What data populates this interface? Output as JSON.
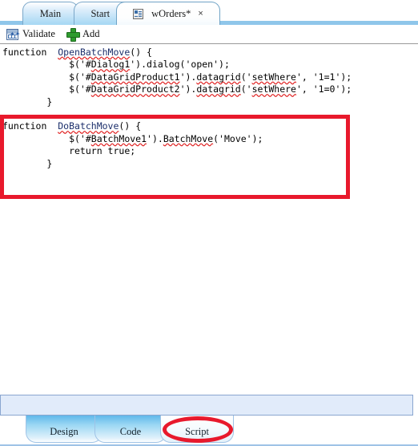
{
  "window": {
    "title": "wOrders* — Script editor"
  },
  "top_tabs": [
    {
      "label": "Main",
      "closable": false,
      "active": false,
      "icon": null
    },
    {
      "label": "Start",
      "closable": true,
      "active": false,
      "icon": null,
      "close": "×"
    },
    {
      "label": "wOrders*",
      "closable": true,
      "active": true,
      "icon": "form-document-icon",
      "close": "×"
    }
  ],
  "toolbar": {
    "validate_label": "Validate",
    "validate_icon": "validate-grid-icon",
    "add_label": "Add",
    "add_icon": "green-plus-icon"
  },
  "editor": {
    "language": "javascript",
    "functions": [
      {
        "name": "OpenBatchMove",
        "lines": [
          "function  OpenBatchMove() {",
          "            $('#Dialog1').dialog('open');",
          "            $('#DataGridProduct1').datagrid('setWhere', '1=1');",
          "            $('#DataGridProduct2').datagrid('setWhere', '1=0');",
          "        }"
        ]
      },
      {
        "name": "DoBatchMove",
        "lines": [
          "function  DoBatchMove() {",
          "            $('#BatchMove1').BatchMove('Move');",
          "            return true;",
          "        }"
        ]
      }
    ],
    "spellcheck_underlined_tokens": [
      "OpenBatchMove",
      "Dialog1",
      "DataGridProduct1",
      "DataGridProduct2",
      "datagrid",
      "setWhere",
      "DoBatchMove",
      "BatchMove1",
      "BatchMove"
    ]
  },
  "annotations": [
    {
      "type": "rectangle",
      "color": "#e8192c",
      "target": "DoBatchMove function block"
    },
    {
      "type": "ellipse",
      "color": "#e8192c",
      "target": "Script tab"
    }
  ],
  "bottom_tabs": [
    {
      "label": "Design",
      "active": false
    },
    {
      "label": "Code",
      "active": false
    },
    {
      "label": "Script",
      "active": true
    }
  ],
  "colors": {
    "annotation_red": "#e8192c",
    "tab_blue": "#9ad7f3",
    "panel_blue": "#e1ebfa",
    "function_name": "#1c2f6b"
  }
}
